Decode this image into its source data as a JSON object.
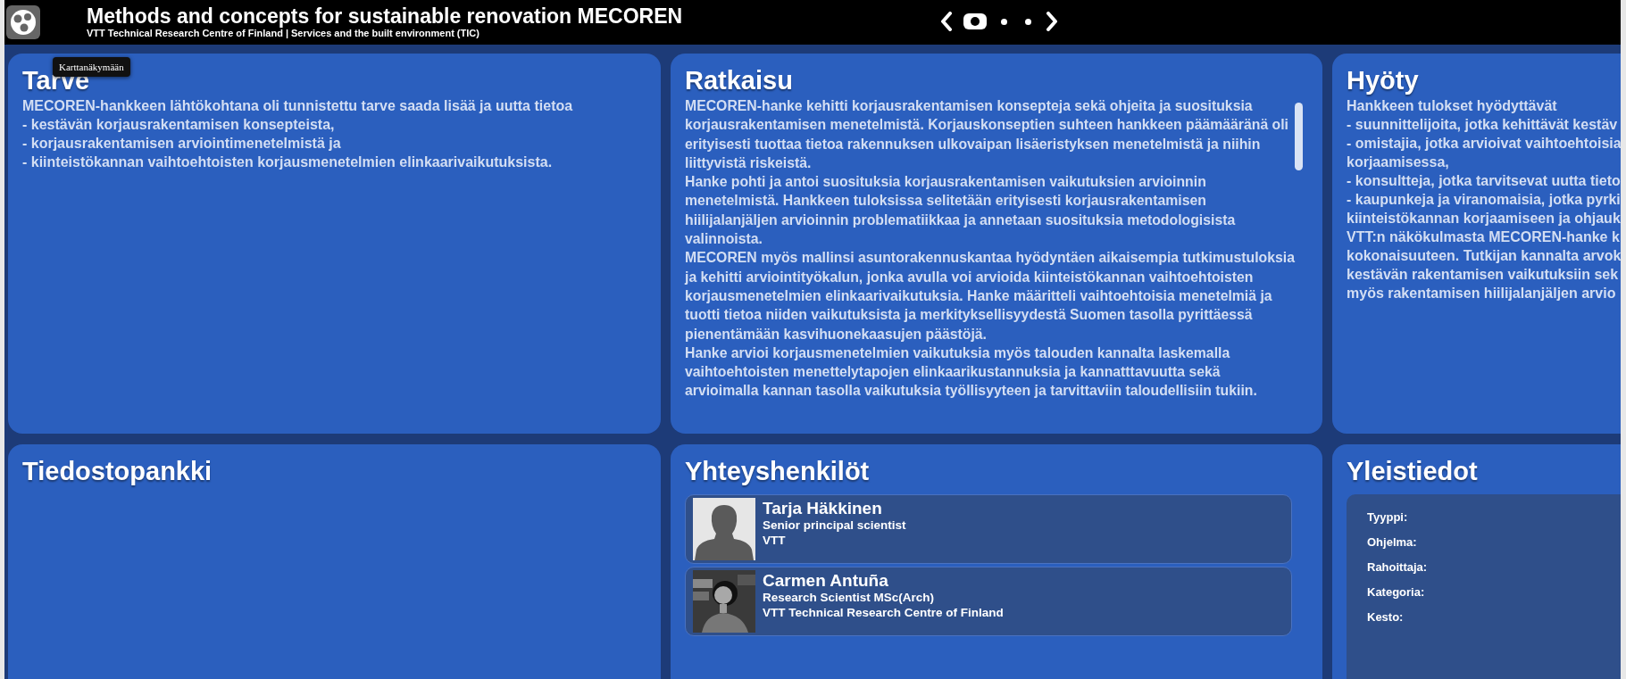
{
  "header": {
    "title": "Methods and concepts for sustainable renovation MECOREN",
    "subtitle": "VTT Technical Research Centre of Finland | Services and the built environment (TIC)",
    "pager": [
      {
        "selected": true
      },
      {
        "selected": false
      },
      {
        "selected": false
      }
    ]
  },
  "tooltip": "Karttanäkymään",
  "tarve": {
    "title": "Tarve",
    "lines": [
      "MECOREN-hankkeen lähtökohtana oli tunnistettu tarve saada lisää ja uutta tietoa",
      "- kestävän korjausrakentamisen konsepteista,",
      "- korjausrakentamisen arviointimenetelmistä ja",
      "- kiinteistökannan vaihtoehtoisten korjausmenetelmien elinkaarivaikutuksista."
    ]
  },
  "ratkaisu": {
    "title": "Ratkaisu",
    "paragraphs": [
      "MECOREN-hanke kehitti korjausrakentamisen konsepteja sekä ohjeita ja suosituksia korjausrakentamisen menetelmistä. Korjauskonseptien suhteen hankkeen päämääränä oli erityisesti tuottaa tietoa rakennuksen ulkovaipan lisäeristyksen menetelmistä ja niihin liittyvistä riskeistä.",
      "Hanke pohti ja antoi suosituksia korjausrakentamisen vaikutuksien arvioinnin menetelmistä. Hankkeen tuloksissa selitetään erityisesti korjausrakentamisen hiilijalanjäljen arvioinnin problematiikkaa ja annetaan suosituksia metodologisista valinnoista.",
      "MECOREN myös mallinsi asuntorakennuskantaa hyödyntäen aikaisempia tutkimustuloksia ja kehitti arviointityökalun, jonka avulla voi arvioida kiinteistökannan vaihtoehtoisten korjausmenetelmien elinkaarivaikutuksia. Hanke määritteli vaihtoehtoisia menetelmiä ja tuotti tietoa niiden vaikutuksista ja merkityksellisyydestä Suomen tasolla pyrittäessä pienentämään kasvihuonekaasujen päästöjä.",
      "Hanke arvioi korjausmenetelmien vaikutuksia myös talouden kannalta laskemalla vaihtoehtoisten menettelytapojen elinkaarikustannuksia ja kannatttavuutta sekä arvioimalla kannan tasolla vaikutuksia työllisyyteen ja tarvittaviin taloudellisiin tukiin."
    ]
  },
  "hyoty": {
    "title": "Hyöty",
    "lines": [
      "Hankkeen tulokset hyödyttävät",
      "- suunnittelijoita, jotka kehittävät kestäv",
      "- omistajia, jotka arvioivat vaihtoehtoisia",
      "korjaamisessa,",
      "- konsultteja, jotka tarvitsevat uutta tieto",
      "- kaupunkeja ja viranomaisia, jotka pyrki",
      "kiinteistökannan korjaamiseen ja  ohjauk",
      "VTT:n näkökulmasta MECOREN-hanke k",
      "kokonaisuuteen. Tutkijan kannalta arvok",
      "kestävän rakentamisen vaikutuksiin sek",
      "myös rakentamisen hiilijalanjäljen arvio"
    ]
  },
  "tiedostopankki": {
    "title": "Tiedostopankki"
  },
  "yhteyshenkilot": {
    "title": "Yhteyshenkilöt",
    "contacts": [
      {
        "kind": "placeholder",
        "name": "Tarja Häkkinen",
        "role": "Senior principal scientist",
        "organization": "VTT"
      },
      {
        "kind": "picture",
        "name": "Carmen Antuña",
        "role": "Research Scientist MSc(Arch)",
        "organization": "VTT Technical Research Centre of Finland"
      }
    ]
  },
  "yleistiedot": {
    "title": "Yleistiedot",
    "fields": [
      "Tyyppi:",
      "Ohjelma:",
      "Rahoittaja:",
      "Kategoria:",
      "Kesto:"
    ]
  }
}
